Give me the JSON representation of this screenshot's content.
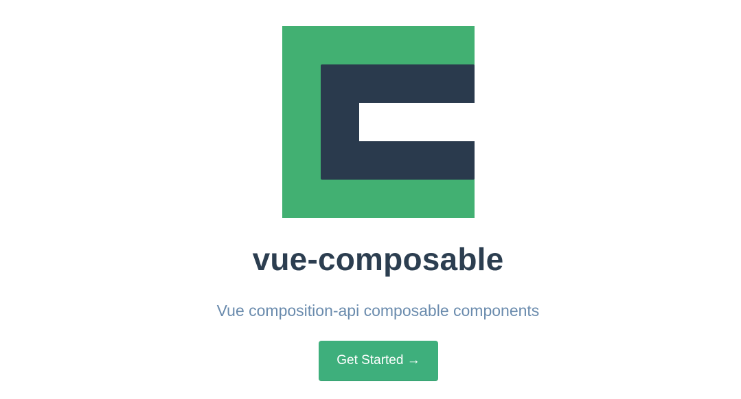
{
  "hero": {
    "logo": {
      "name": "vue-composable-logo",
      "outer_color": "#42b072",
      "inner_color": "#2a3a4d",
      "cutout_color": "#ffffff"
    },
    "title": "vue-composable",
    "description": "Vue composition-api composable components",
    "action": {
      "label": "Get Started →",
      "background": "#3eaf7c",
      "text_color": "#ffffff"
    }
  }
}
